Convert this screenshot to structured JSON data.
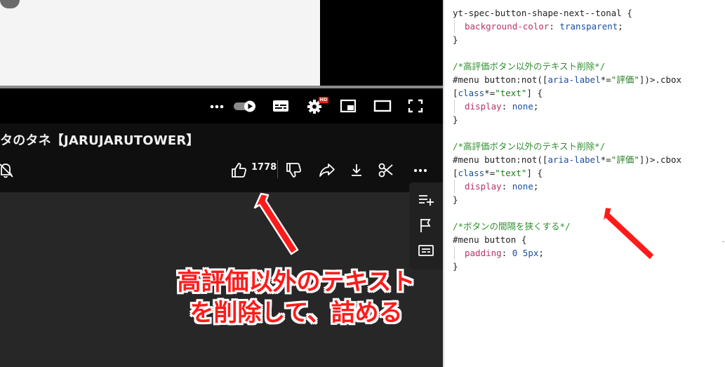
{
  "video": {
    "title": "タのタネ【JARUJARUTOWER】",
    "like_count": "1778",
    "settings_badge": "HD"
  },
  "player_controls": [
    {
      "name": "more-options-icon",
      "glyph": "•••"
    },
    {
      "name": "autoplay-toggle",
      "glyph": ""
    },
    {
      "name": "subtitles-icon",
      "glyph": ""
    },
    {
      "name": "settings-gear-icon",
      "glyph": ""
    },
    {
      "name": "miniplayer-icon",
      "glyph": ""
    },
    {
      "name": "theater-mode-icon",
      "glyph": ""
    },
    {
      "name": "fullscreen-icon",
      "glyph": ""
    }
  ],
  "actions": {
    "more_glyph": "•••"
  },
  "annotation": {
    "line1": "高評価以外のテキスト",
    "line2": "を削除して、詰める"
  },
  "colors": {
    "annotation_red": "#ff1a1a",
    "arrow_red": "#ff1a1a",
    "player_bg": "#0f0f0f",
    "comment_green": "#2f8f2f",
    "property_pink": "#b8326b",
    "value_blue": "#1a4fa0"
  },
  "editor": {
    "lines": [
      {
        "type": "partial",
        "text": "yt-spec-button-shape-next--tonal {"
      },
      {
        "type": "prop",
        "prop": "background-color",
        "value": "transparent"
      },
      {
        "type": "brace",
        "text": "}"
      },
      {
        "type": "blank",
        "text": ""
      },
      {
        "type": "comment",
        "text": "/*高評価ボタン以外のテキスト削除*/"
      },
      {
        "type": "selector1",
        "text": "#menu button:not([aria-label*=\"評価\"])>.cbox"
      },
      {
        "type": "selector2",
        "text": "[class*=\"text\"] {"
      },
      {
        "type": "prop",
        "prop": "display",
        "value": "none"
      },
      {
        "type": "brace",
        "text": "}"
      },
      {
        "type": "blank",
        "text": ""
      },
      {
        "type": "comment",
        "text": "/*高評価ボタン以外のテキスト削除*/"
      },
      {
        "type": "selector1",
        "text": "#menu button:not([aria-label*=\"評価\"])>.cbox"
      },
      {
        "type": "selector2",
        "text": "[class*=\"text\"] {"
      },
      {
        "type": "prop",
        "prop": "display",
        "value": "none"
      },
      {
        "type": "brace",
        "text": "}"
      },
      {
        "type": "blank",
        "text": ""
      },
      {
        "type": "comment",
        "text": "/*ボタンの間隔を狭くする*/"
      },
      {
        "type": "selector",
        "text": "#menu button {"
      },
      {
        "type": "prop",
        "prop": "padding",
        "value": "0 5px"
      },
      {
        "type": "brace",
        "text": "}"
      }
    ]
  }
}
